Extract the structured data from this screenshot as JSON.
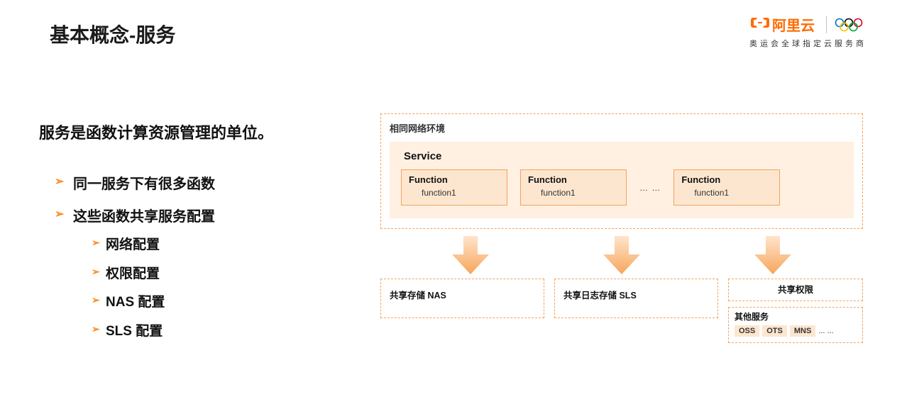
{
  "header": {
    "brand_text": "阿里云",
    "tagline": "奥运会全球指定云服务商"
  },
  "title": "基本概念-服务",
  "intro": "服务是函数计算资源管理的单位。",
  "bullets": [
    {
      "text": "同一服务下有很多函数"
    },
    {
      "text": "这些函数共享服务配置",
      "sub": [
        "网络配置",
        "权限配置",
        "NAS 配置",
        "SLS 配置"
      ]
    }
  ],
  "diagram": {
    "env_label": "相同网络环境",
    "service_title": "Service",
    "function_label": "Function",
    "function_name": "function1",
    "ellipsis": "… …",
    "share_nas": "共享存储 NAS",
    "share_sls": "共享日志存储 SLS",
    "share_perm": "共享权限",
    "other_services_title": "其他服务",
    "other_services": [
      "OSS",
      "OTS",
      "MNS"
    ],
    "other_ellipsis": "... ..."
  },
  "colors": {
    "accent": "#ff6a00",
    "box_border": "#f5a25c",
    "box_fill_light": "#fff0e2",
    "box_fill_mid": "#fde6cf"
  }
}
